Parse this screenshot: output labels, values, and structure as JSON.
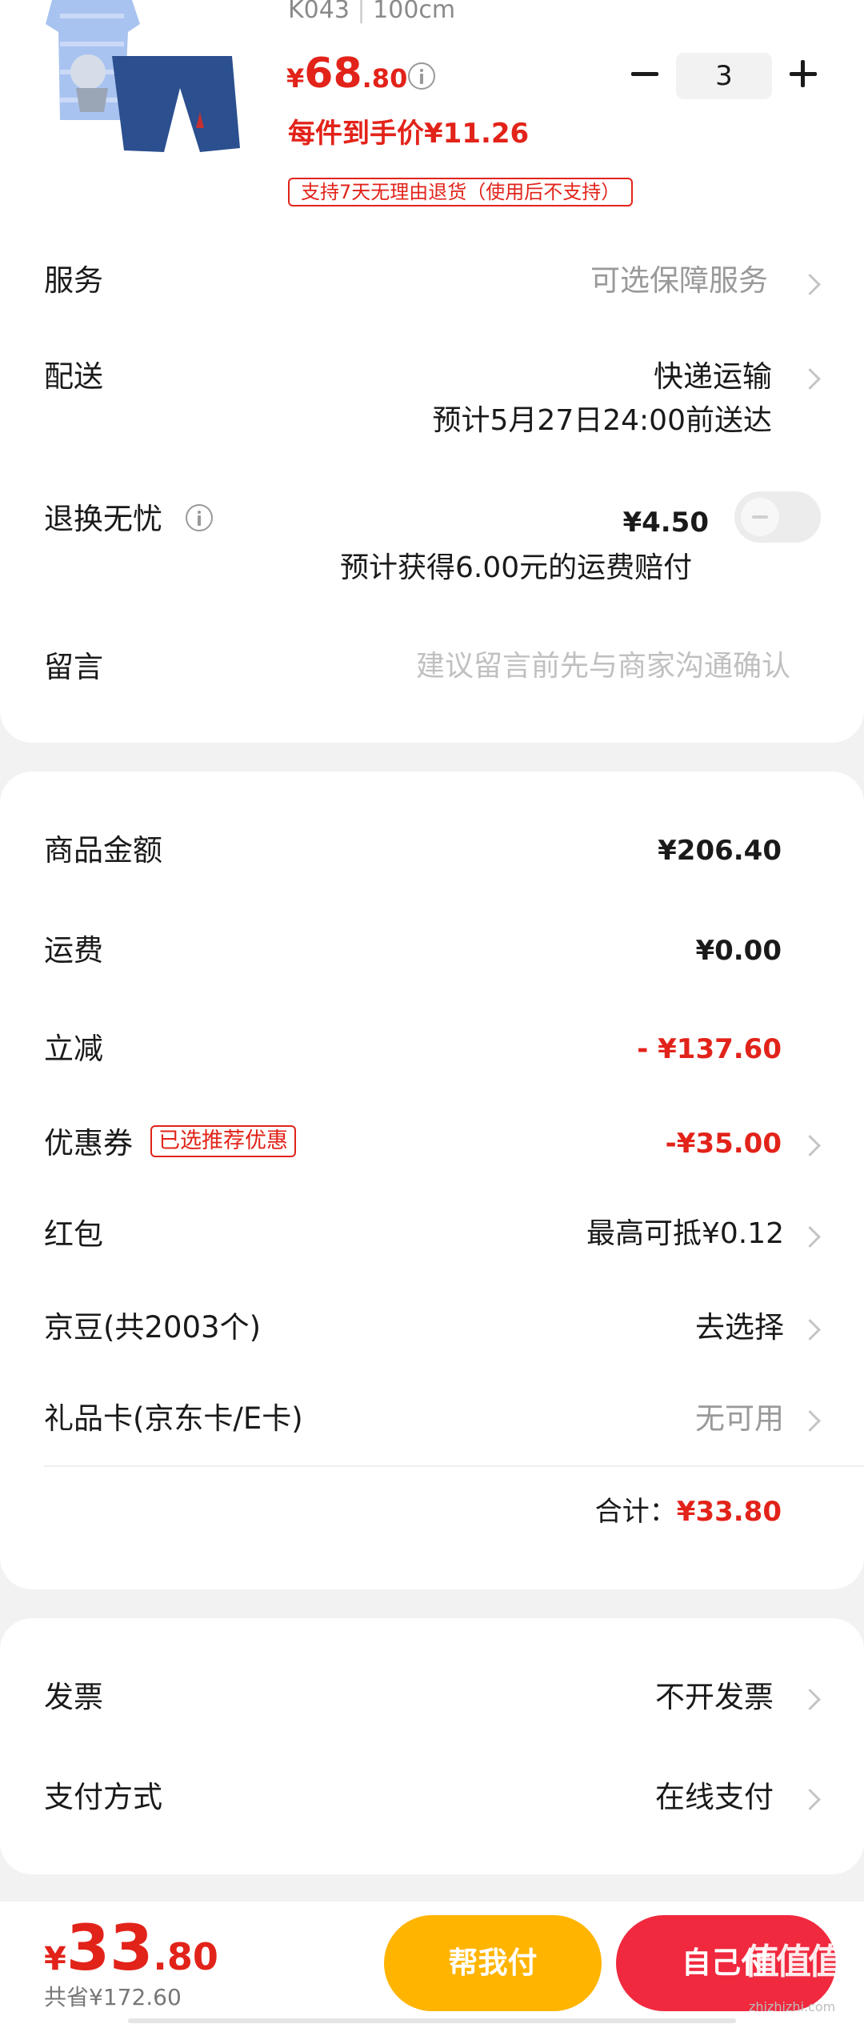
{
  "product": {
    "spec": "K043",
    "size": "100cm",
    "price_symbol": "¥",
    "price_int": "68",
    "price_dec": ".80",
    "unit_price_text": "每件到手价¥11.26",
    "return_tag": "支持7天无理由退货（使用后不支持）",
    "quantity": "3",
    "image_icon": "clothing-set-icon"
  },
  "order": {
    "service": {
      "label": "服务",
      "value": "可选保障服务"
    },
    "delivery": {
      "label": "配送",
      "value": "快递运输",
      "eta": "预计5月27日24:00前送达"
    },
    "return_worry": {
      "label": "退换无忧",
      "value": "¥4.50",
      "note": "预计获得6.00元的运费赔付",
      "enabled": false
    },
    "message": {
      "label": "留言",
      "placeholder": "建议留言前先与商家沟通确认"
    }
  },
  "summary": {
    "goods_amount": {
      "label": "商品金额",
      "value": "¥206.40"
    },
    "shipping": {
      "label": "运费",
      "value": "¥0.00"
    },
    "discount": {
      "label": "立减",
      "value": "- ¥137.60"
    },
    "coupon": {
      "label": "优惠券",
      "tag": "已选推荐优惠",
      "value": "-¥35.00"
    },
    "red_packet": {
      "label": "红包",
      "value": "最高可抵¥0.12"
    },
    "jingdou": {
      "label": "京豆(共2003个)",
      "value": "去选择"
    },
    "gift_card": {
      "label": "礼品卡(京东卡/E卡)",
      "value": "无可用"
    },
    "total_label": "合计：",
    "total_value": "¥33.80"
  },
  "invoice": {
    "label": "发票",
    "value": "不开发票"
  },
  "payment": {
    "label": "支付方式",
    "value": "在线支付"
  },
  "bottom": {
    "symbol": "¥",
    "total_int": "33",
    "total_dec": ".80",
    "saved": "共省¥172.60",
    "help_pay": "帮我付",
    "self_pay": "自己付"
  },
  "watermark": {
    "text": "值",
    "url": "zhizhizhi.com"
  },
  "colors": {
    "accent": "#e2231a",
    "help_pay_bg": "#ffb400",
    "self_pay_bg": "#f0293e"
  }
}
